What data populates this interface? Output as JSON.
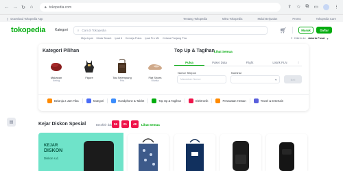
{
  "browser": {
    "url": "tokopedia.com"
  },
  "top_strip": {
    "download_label": "Download Tokopedia App",
    "links": [
      "Tentang Tokopedia",
      "Mitra Tokopedia",
      "Mulai Berjualan",
      "Promo",
      "Tokopedia Care"
    ]
  },
  "header": {
    "logo": "tokopedia",
    "kategori": "Kategori",
    "search_placeholder": "Cari di Tokopedia",
    "masuk": "Masuk",
    "daftar": "Daftar",
    "sub_links": [
      "Meja Lipat",
      "Meda Tenant",
      "Ipad 6",
      "Kemeja Polos",
      "Ipad Pro M1",
      "Celana Panjang Pria"
    ],
    "location_prefix": "Dikirim ke",
    "location_value": "Jakarta Pusat"
  },
  "kategori_pilihan": {
    "title": "Kategori Pilihan",
    "items": [
      {
        "name": "Makanan",
        "count": "Kering",
        "color": "#8b1e1e"
      },
      {
        "name": "Figure",
        "count": "",
        "color": "#2a2a2a"
      },
      {
        "name": "Tas Selempang",
        "count": "Pria",
        "color": "#4a3422"
      },
      {
        "name": "Flat Shoes",
        "count": "Wanita",
        "color": "#cfa98a"
      }
    ]
  },
  "top_up": {
    "title": "Top Up & Tagihan",
    "link": "Lihat Semua",
    "tabs": [
      "Pulsa",
      "Paket Data",
      "Flight",
      "Listrik PLN"
    ],
    "active_tab": 0,
    "more": "⋮",
    "phone_label": "Nomor Telepon",
    "phone_placeholder": "Masukkan Nomor",
    "nominal_label": "Nominal",
    "buy_label": "Beli"
  },
  "categories": [
    {
      "label": "Belanja 2 Jam Tiba",
      "color": "#ff8a00"
    },
    {
      "label": "Kategori",
      "color": "#4a6cf7"
    },
    {
      "label": "Handphone & Tablet",
      "color": "#3c8dfc"
    },
    {
      "label": "Top Up & Tagihan",
      "color": "#03ac0e"
    },
    {
      "label": "Elektronik",
      "color": "#ef144a"
    },
    {
      "label": "Perawatan Hewan",
      "color": "#ff8a00"
    },
    {
      "label": "Travel & Entertain",
      "color": "#5a5fdc"
    }
  ],
  "kejar_diskon": {
    "title": "Kejar Diskon Spesial",
    "ends_label": "Berakhir dalam",
    "timer": [
      "06",
      "01",
      "48"
    ],
    "link": "Lihat Semua",
    "promo_line1": "KEJAR",
    "promo_line2": "DISKON",
    "promo_line3": "Diskon s.d."
  },
  "colors": {
    "brand": "#03ac0e",
    "timer": "#ef144a",
    "promo_bg": "#6fe3c9"
  }
}
